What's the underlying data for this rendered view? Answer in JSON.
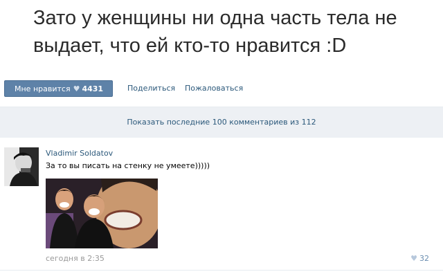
{
  "post": {
    "headline": "Зато у женщины ни одна часть тела не выдает, что ей кто-то нравится :D"
  },
  "actions": {
    "like_label": "Мне нравится",
    "like_count": "4431",
    "share_label": "Поделиться",
    "report_label": "Пожаловаться"
  },
  "comments": {
    "show_label": "Показать последние 100 комментариев из 112",
    "items": [
      {
        "author": "Vladimir Soldatov",
        "text": "За то вы писать на стенку не умеете)))))",
        "time": "сегодня в 2:35",
        "likes": "32"
      }
    ]
  },
  "icons": {
    "like": "heart-icon",
    "avatar": "avatar",
    "photo": "laughing-men-photo"
  },
  "colors": {
    "like_button_bg": "#5e82a8",
    "link": "#2b587a",
    "show_comments_bg": "#edf0f4",
    "muted": "#999999"
  }
}
